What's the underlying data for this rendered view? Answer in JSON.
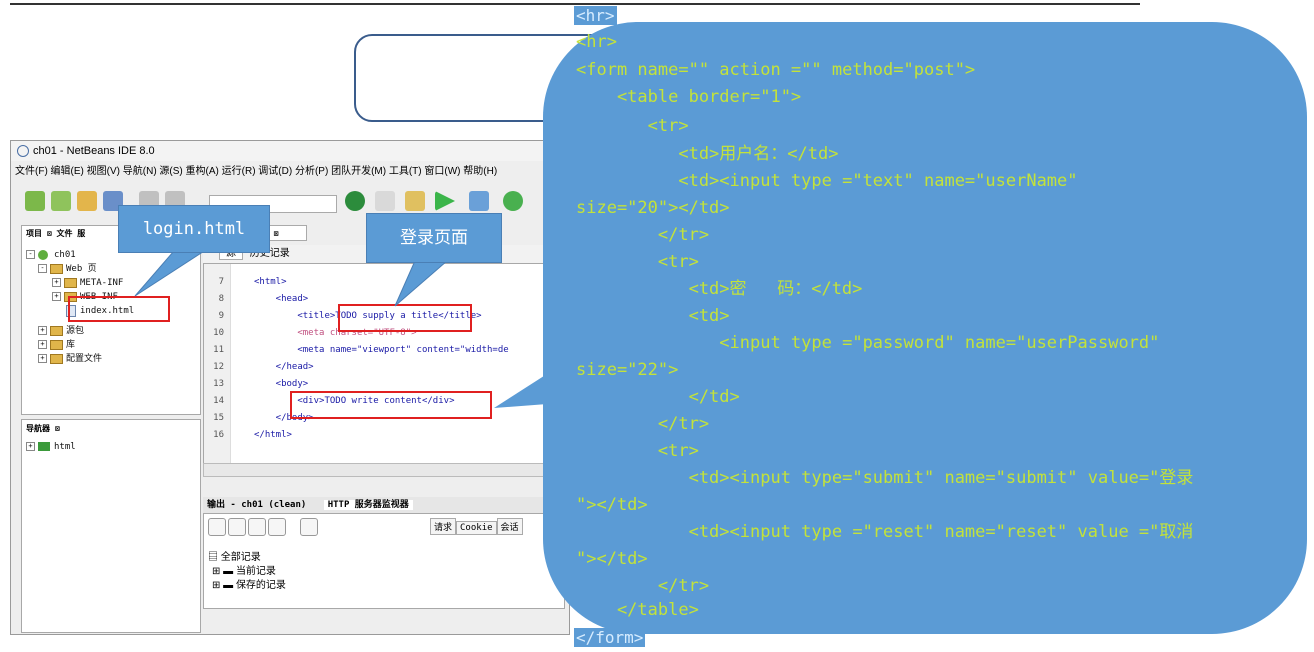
{
  "ide": {
    "title": "ch01 - NetBeans IDE 8.0",
    "menu": "文件(F) 编辑(E) 视图(V) 导航(N) 源(S) 重构(A) 运行(R) 调试(D) 分析(P) 团队开发(M) 工具(T) 窗口(W) 帮助(H)",
    "project_tabs": [
      "项目",
      "文件",
      "服"
    ],
    "tree": {
      "root": "ch01",
      "web_pages": "Web 页",
      "meta_inf": "META-INF",
      "web_inf": "WEB-INF",
      "index_file": "index.html",
      "source_pkg": "源包",
      "libraries": "库",
      "config_files": "配置文件"
    },
    "navigator": {
      "title": "导航器",
      "item": "html"
    },
    "editor": {
      "tab_label": "1",
      "source_tab": "源",
      "history_tab": "历史记录",
      "line_numbers": [
        "7",
        "8",
        "9",
        "10",
        "11",
        "12",
        "13",
        "14",
        "15",
        "16"
      ],
      "lines": [
        "<html>",
        "    <head>",
        "        <title>TODO supply a title</title>",
        "        <meta charset=\"UTF-8\">",
        "        <meta name=\"viewport\" content=\"width=de",
        "    </head>",
        "    <body>",
        "        <div>TODO write content</div>",
        "    </body>",
        "</html>"
      ]
    },
    "output": {
      "tab1": "输出 - ch01 (clean)",
      "tab2": "HTTP 服务器监视器",
      "records": [
        "全部记录",
        "当前记录",
        "保存的记录"
      ],
      "request_tabs": [
        "请求",
        "Cookie",
        "会话"
      ]
    }
  },
  "callouts": {
    "login": "login.html",
    "page": "登录页面"
  },
  "bubble": {
    "hr_top": "<hr>",
    "lines": [
      "<hr>",
      "<form name=\"\" action =\"\" method=\"post\">",
      "    <table border=\"1\">",
      "       <tr>",
      "          <td>用户名：</td>",
      "          <td><input type =\"text\" name=\"userName\"",
      "size=\"20\"></td>",
      "        </tr>",
      "        <tr>",
      "           <td>密   码：</td>",
      "           <td>",
      "              <input type =\"password\" name=\"userPassword\"",
      "size=\"22\">",
      "           </td>",
      "        </tr>",
      "        <tr>",
      "           <td><input type=\"submit\" name=\"submit\" value=\"登录",
      "\"></td>",
      "           <td><input type =\"reset\" name=\"reset\" value =\"取消",
      "\"></td>",
      "        </tr>",
      "    </table>"
    ],
    "form_close": "</form>"
  }
}
